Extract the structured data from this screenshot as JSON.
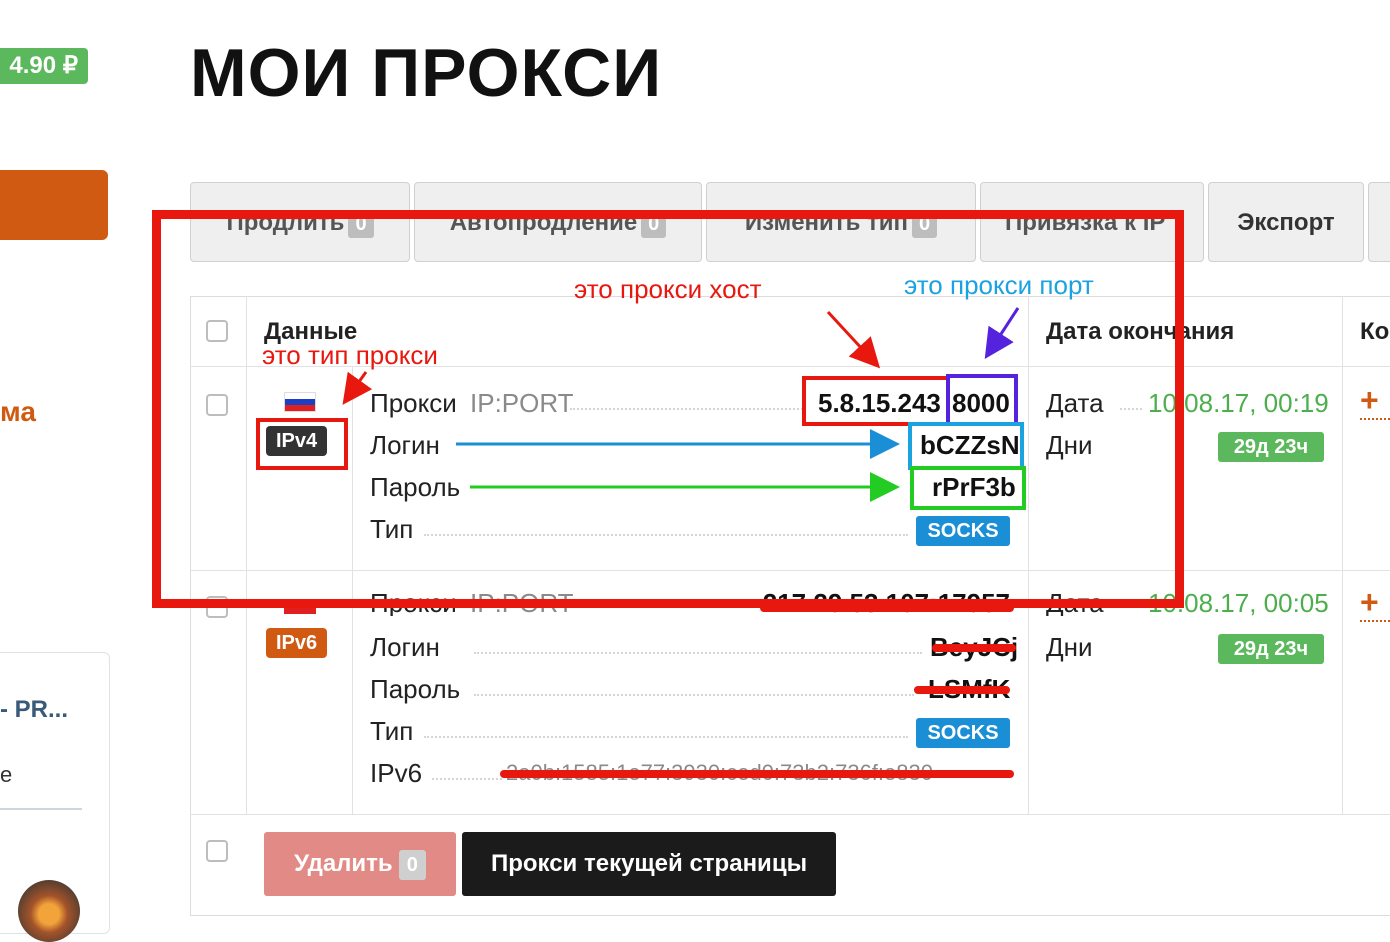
{
  "sidebar": {
    "balance": "4.90 ₽",
    "promo_fragment": "ма",
    "card_title_fragment": "- PR...",
    "card_text_fragment": "е"
  },
  "page": {
    "title": "МОИ ПРОКСИ"
  },
  "toolbar": {
    "buttons": [
      {
        "label": "Продлить",
        "count": "0"
      },
      {
        "label": "Автопродление",
        "count": "0"
      },
      {
        "label": "Изменить тип",
        "count": "0"
      },
      {
        "label": "Привязка к IP"
      },
      {
        "label": "Экспорт"
      }
    ]
  },
  "table": {
    "headers": {
      "data": "Данные",
      "expiry": "Дата окончания",
      "extra": "Ко"
    },
    "rows": [
      {
        "type_badge": "IPv4",
        "type_badge_color": "#333333",
        "proxy_label": "Прокси",
        "proxy_hint": "IP:PORT",
        "host": "5.8.15.243",
        "port": "8000",
        "login_label": "Логин",
        "login": "bCZZsN",
        "password_label": "Пароль",
        "password": "rPrF3b",
        "type_label": "Тип",
        "type": "SOCKS",
        "date_label": "Дата",
        "date": "10.08.17, 00:19",
        "days_label": "Дни",
        "days": "29д 23ч"
      },
      {
        "type_badge": "IPv6",
        "type_badge_color": "#d05a12",
        "proxy_label": "Прокси",
        "proxy_hint": "IP:PORT",
        "host_port": "217.29.53.107:17957",
        "login_label": "Логин",
        "login": "BeyJCj",
        "password_label": "Пароль",
        "password": "LSMfK",
        "type_label": "Тип",
        "type": "SOCKS",
        "ipv6_label": "IPv6",
        "ipv6": "2a0b:1585:1e77:3930:ced0:73b2:736f:e830",
        "date_label": "Дата",
        "date": "10.08.17, 00:05",
        "days_label": "Дни",
        "days": "29д 23ч"
      }
    ]
  },
  "footer": {
    "delete_label": "Удалить",
    "delete_count": "0",
    "page_proxies_label": "Прокси текущей страницы"
  },
  "annotations": {
    "host_note": "это прокси хост",
    "port_note": "это прокси порт",
    "type_note": "это тип прокси",
    "red": "#e8180f",
    "blue": "#1aa3e0",
    "green": "#22cc22",
    "purple": "#5522dd"
  }
}
